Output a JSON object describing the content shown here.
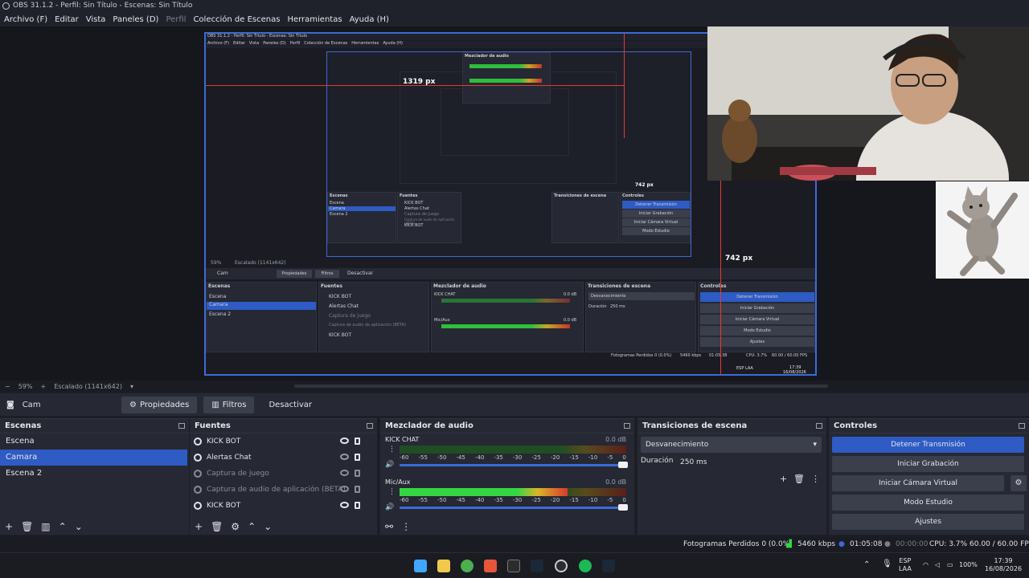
{
  "window": {
    "title": "OBS 31.1.2 - Perfil: Sin Título - Escenas: Sin Título"
  },
  "menu": {
    "items": [
      "Archivo (F)",
      "Editar",
      "Vista",
      "Paneles (D)",
      "Perfil",
      "Colección de Escenas",
      "Herramientas",
      "Ayuda (H)"
    ]
  },
  "preview": {
    "width_label": "1319 px",
    "height_label": "742 px",
    "height_label_small": "742 px",
    "nested_title": "OBS 31.1.2 - Perfil: Sin Título - Escenas: Sin Título",
    "nested_menu": [
      "Archivo (F)",
      "Editar",
      "Vista",
      "Paneles (D)",
      "Perfil",
      "Colección de Escenas",
      "Herramientas",
      "Ayuda (H)"
    ],
    "nested_zoom": "59%",
    "nested_scale": "Escalado (1141x642)",
    "nested_source": "Cam",
    "nested_props": "Propiedades",
    "nested_filters": "Filtros",
    "nested_deactivate": "Desactivar",
    "nested_panels": {
      "scenes": "Escenas",
      "sources": "Fuentes",
      "mixer": "Mezclador de audio",
      "transitions": "Transiciones de escena",
      "controls": "Controles"
    },
    "nested_scenes": [
      "Escena",
      "Camara",
      "Escena 2"
    ],
    "nested_sources": [
      "KICK BOT",
      "Alertas Chat",
      "Captura de juego",
      "Captura de audio de aplicación (BETA)",
      "KICK BOT"
    ],
    "nested_controls": [
      "Detener Transmisión",
      "Iniciar Grabación",
      "Iniciar Cámara Virtual",
      "Modo Estudio",
      "Ajustes"
    ],
    "nested_status": "Fotogramas Perdidos 0 (0.0%)",
    "nested_kbps": "5460 kbps",
    "nested_time": "01:05:38",
    "nested_cpu": "CPU: 3.7%",
    "nested_fps": "60.00 / 60.00 FPS",
    "nested_mixer_ch1": "KICK CHAT",
    "nested_mixer_ch2": "Mic/Aux",
    "nested_db": "0.0 dB",
    "nested_trans": "Desvanecimiento",
    "nested_dur_label": "Duración",
    "nested_dur": "250 ms",
    "nested_clock": "17:39",
    "nested_date": "16/08/2026",
    "nested_lang": "ESP LAA"
  },
  "canvas_toolbar": {
    "zoom": "59%",
    "scale": "Escalado (1141x642)"
  },
  "source_bar": {
    "source_name": "Cam",
    "properties": "Propiedades",
    "filters": "Filtros",
    "deactivate": "Desactivar"
  },
  "scenes": {
    "title": "Escenas",
    "items": [
      {
        "label": "Escena",
        "selected": false
      },
      {
        "label": "Camara",
        "selected": true
      },
      {
        "label": "Escena 2",
        "selected": false
      }
    ]
  },
  "sources": {
    "title": "Fuentes",
    "items": [
      {
        "label": "KICK BOT",
        "visible": true,
        "dim": false
      },
      {
        "label": "Alertas Chat",
        "visible": false,
        "dim": false
      },
      {
        "label": "Captura de juego",
        "visible": false,
        "dim": true
      },
      {
        "label": "Captura de audio de aplicación (BETA)",
        "visible": false,
        "dim": true
      },
      {
        "label": "KICK BOT",
        "visible": true,
        "dim": false
      }
    ]
  },
  "mixer": {
    "title": "Mezclador de audio",
    "channels": [
      {
        "name": "KICK CHAT",
        "db": "0.0 dB",
        "level": 0.0
      },
      {
        "name": "Mic/Aux",
        "db": "0.0 dB",
        "level": 0.74
      }
    ],
    "scale": [
      "-60",
      "-55",
      "-50",
      "-45",
      "-40",
      "-35",
      "-30",
      "-25",
      "-20",
      "-15",
      "-10",
      "-5",
      "0"
    ]
  },
  "transitions": {
    "title": "Transiciones de escena",
    "selected": "Desvanecimiento",
    "duration_label": "Duración",
    "duration": "250 ms"
  },
  "controls": {
    "title": "Controles",
    "stop_stream": "Detener Transmisión",
    "start_recording": "Iniciar Grabación",
    "start_vcam": "Iniciar Cámara Virtual",
    "studio_mode": "Modo Estudio",
    "settings": "Ajustes"
  },
  "status": {
    "dropped": "Fotogramas Perdidos 0 (0.0%)",
    "bitrate": "5460 kbps",
    "stream_time": "01:05:08",
    "rec_time": "00:00:00",
    "cpu": "CPU: 3.7%",
    "fps": "60.00 / 60.00 FPS"
  },
  "taskbar": {
    "lang_line1": "ESP",
    "lang_line2": "LAA",
    "battery": "100%",
    "time": "17:39",
    "date": "16/08/2026"
  },
  "colors": {
    "accent": "#2e5bc4",
    "selection_border": "#3b6ad9",
    "guide_red": "#e53935",
    "meter_green": "#35d644",
    "meter_yellow": "#d9b62a",
    "meter_red": "#d83b2e"
  }
}
